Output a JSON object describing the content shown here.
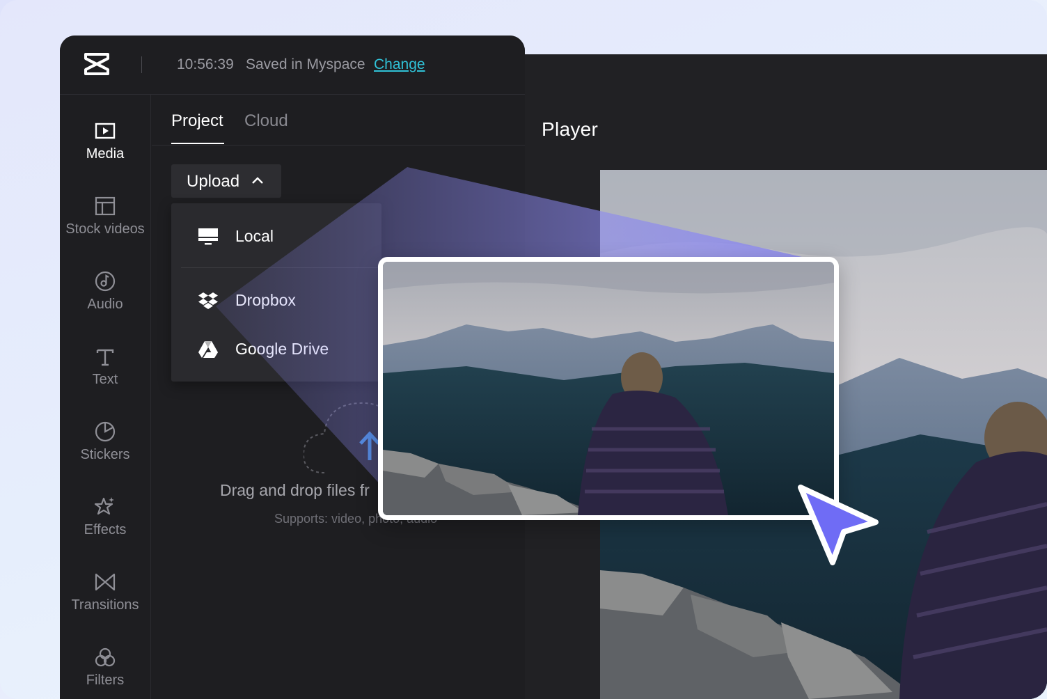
{
  "topbar": {
    "logo": "capcut-logo",
    "save_time": "10:56:39",
    "save_text": "Saved in Myspace",
    "change_link": "Change"
  },
  "sidebar": {
    "items": [
      {
        "label": "Media",
        "icon": "media-play-icon",
        "active": true
      },
      {
        "label": "Stock videos",
        "icon": "layout-grid-icon",
        "active": false
      },
      {
        "label": "Audio",
        "icon": "music-note-icon",
        "active": false
      },
      {
        "label": "Text",
        "icon": "text-t-icon",
        "active": false
      },
      {
        "label": "Stickers",
        "icon": "sticker-icon",
        "active": false
      },
      {
        "label": "Effects",
        "icon": "sparkle-star-icon",
        "active": false
      },
      {
        "label": "Transitions",
        "icon": "bowtie-icon",
        "active": false
      },
      {
        "label": "Filters",
        "icon": "filter-circles-icon",
        "active": false
      }
    ]
  },
  "tabs": [
    {
      "label": "Project",
      "active": true
    },
    {
      "label": "Cloud",
      "active": false
    }
  ],
  "upload": {
    "label": "Upload",
    "menu": [
      {
        "label": "Local",
        "icon": "monitor-icon"
      },
      {
        "label": "Dropbox",
        "icon": "dropbox-icon"
      },
      {
        "label": "Google Drive",
        "icon": "google-drive-icon"
      }
    ]
  },
  "drop_zone": {
    "title": "Drag and drop files fr",
    "subtitle": "Supports: video, photo, audio"
  },
  "player": {
    "title": "Player"
  },
  "colors": {
    "accent_link": "#30c2d7",
    "beam": "#8b88f0",
    "cursor": "#6f6cf5",
    "panel_bg": "#1e1e21"
  }
}
